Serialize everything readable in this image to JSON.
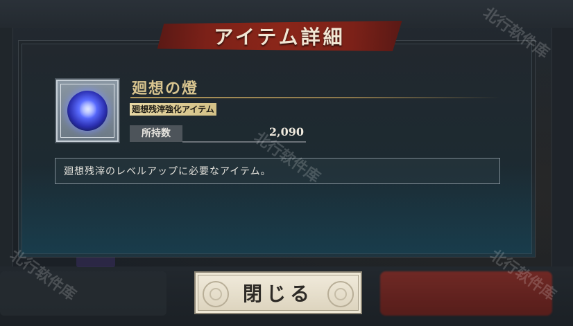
{
  "dialog": {
    "title": "アイテム詳細",
    "item": {
      "name": "廻想の燈",
      "category": "廻想残滓強化アイテム",
      "owned_label": "所持数",
      "owned_value": "2,090",
      "description": "廻想残滓のレベルアップに必要なアイテム。",
      "icon": "blue-orb-icon"
    },
    "close_label": "閉じる"
  },
  "watermark": "北行软件库",
  "colors": {
    "title_banner": "#7c2118",
    "item_name": "#d8c48f",
    "category_badge": "#e8d8a4",
    "close_button": "#f1ebdc"
  }
}
